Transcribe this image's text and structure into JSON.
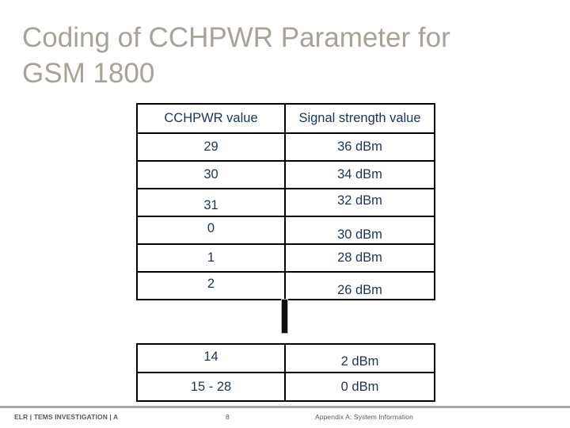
{
  "slide": {
    "title": "Coding of CCHPWR Parameter for\nGSM 1800",
    "title_color": "#a8a298",
    "background_color": "#ffffff",
    "text_color": "#1c3557",
    "border_color": "#000000"
  },
  "table_top": {
    "headers": [
      "CCHPWR value",
      "Signal strength value"
    ],
    "rows": [
      [
        "29",
        "36 dBm"
      ],
      [
        "30",
        "34 dBm"
      ],
      [
        "31",
        "32 dBm"
      ],
      [
        "0",
        "30 dBm"
      ],
      [
        "1",
        "28 dBm"
      ],
      [
        "2",
        "26 dBm"
      ]
    ]
  },
  "continuation": {
    "symbol": "vertical-ellipsis-bar"
  },
  "table_bottom": {
    "rows": [
      [
        "14",
        "2 dBm"
      ],
      [
        "15 - 28",
        "0 dBm"
      ]
    ]
  },
  "footer": {
    "left": "ELR | TEMS INVESTIGATION | A",
    "page": "8",
    "right": "Appendix A: System Information"
  },
  "chart_data": {
    "type": "table",
    "title": "Coding of CCHPWR Parameter for GSM 1800",
    "columns": [
      "CCHPWR value",
      "Signal strength value"
    ],
    "rows": [
      [
        "29",
        "36 dBm"
      ],
      [
        "30",
        "34 dBm"
      ],
      [
        "31",
        "32 dBm"
      ],
      [
        "0",
        "30 dBm"
      ],
      [
        "1",
        "28 dBm"
      ],
      [
        "2",
        "26 dBm"
      ],
      [
        "⋮",
        "⋮"
      ],
      [
        "14",
        "2 dBm"
      ],
      [
        "15 - 28",
        "0 dBm"
      ]
    ],
    "notes": "Rows between CCHPWR 2 and 14 are elided and indicated by a vertical continuation mark."
  }
}
